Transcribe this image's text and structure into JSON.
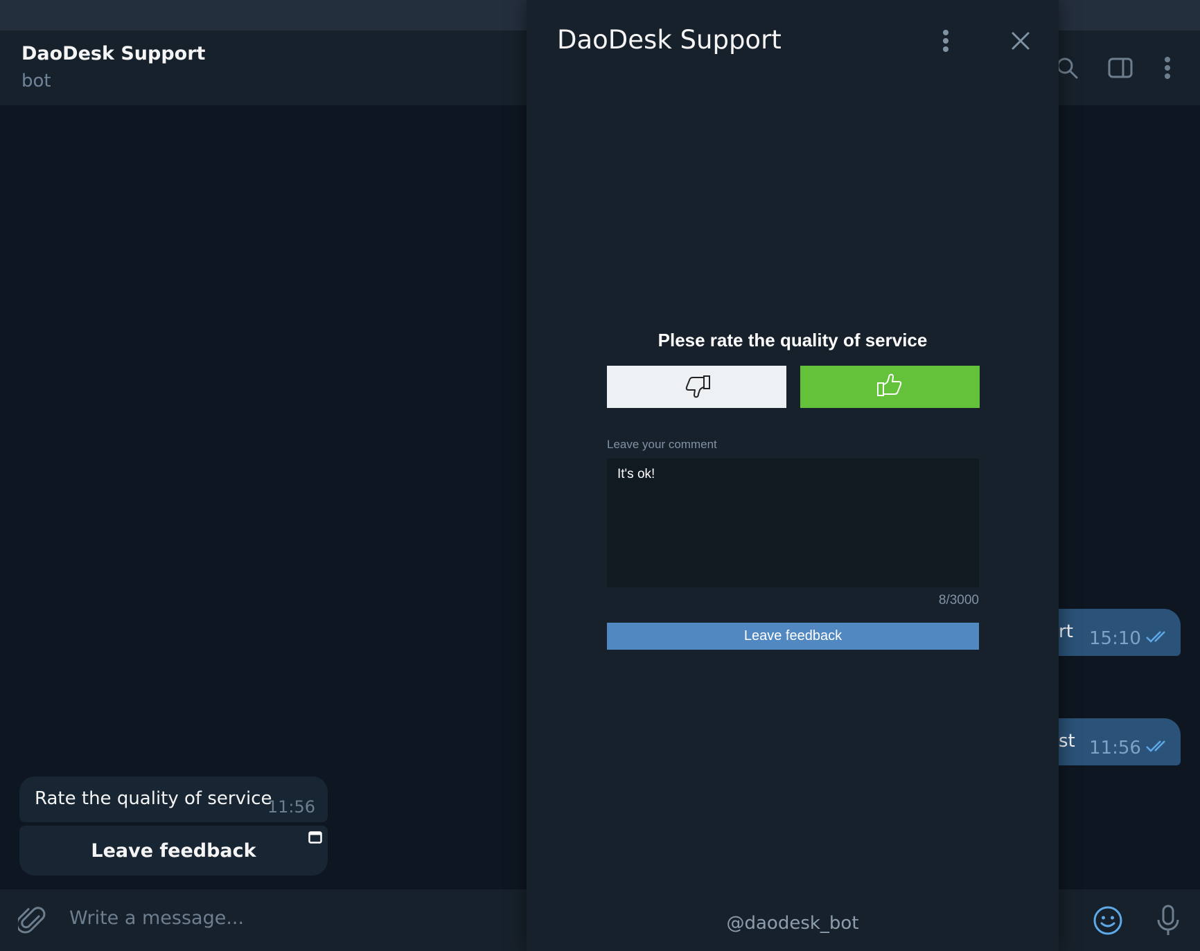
{
  "chat": {
    "title": "DaoDesk Support",
    "subtitle": "bot",
    "incoming_message": {
      "text": "Rate the quality of service",
      "time": "11:56"
    },
    "inline_button": {
      "label": "Leave feedback",
      "icon": "open-app-icon"
    },
    "outgoing_messages": [
      {
        "text_fragment": "rt",
        "time": "15:10",
        "status": "read"
      },
      {
        "text_fragment": "st",
        "time": "11:56",
        "status": "read"
      }
    ],
    "composer": {
      "placeholder": "Write a message..."
    },
    "header_icons": [
      "search-icon",
      "sidebar-toggle-icon",
      "more-vertical-icon"
    ],
    "composer_icons": [
      "attach-icon",
      "emoji-icon",
      "microphone-icon"
    ]
  },
  "webapp": {
    "title": "DaoDesk Support",
    "rating": {
      "heading": "Plese rate the quality of service",
      "options": [
        {
          "name": "thumbs-down",
          "icon": "thumbs-down-icon",
          "selected": false
        },
        {
          "name": "thumbs-up",
          "icon": "thumbs-up-icon",
          "selected": true
        }
      ]
    },
    "comment": {
      "label": "Leave your comment",
      "value": "It's ok!",
      "counter": "8/3000"
    },
    "submit_label": "Leave feedback",
    "footer": "@daodesk_bot"
  },
  "colors": {
    "background": "#0e1621",
    "panel": "#17212b",
    "accent": "#5288c1",
    "positive": "#64c13a",
    "outgoing_bubble": "#2b5278"
  }
}
